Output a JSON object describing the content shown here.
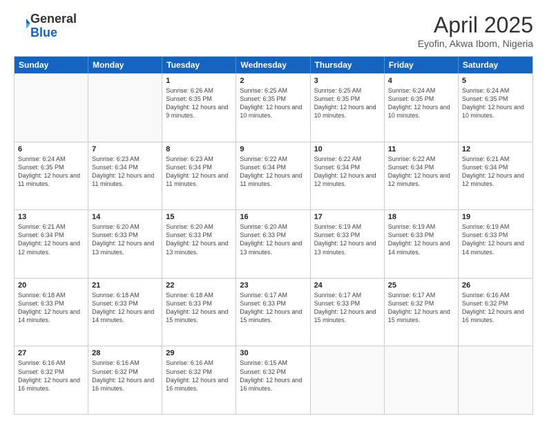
{
  "logo": {
    "general": "General",
    "blue": "Blue"
  },
  "header": {
    "month": "April 2025",
    "location": "Eyofin, Akwa Ibom, Nigeria"
  },
  "days_of_week": [
    "Sunday",
    "Monday",
    "Tuesday",
    "Wednesday",
    "Thursday",
    "Friday",
    "Saturday"
  ],
  "weeks": [
    [
      {
        "day": "",
        "empty": true
      },
      {
        "day": "",
        "empty": true
      },
      {
        "day": "1",
        "sunrise": "Sunrise: 6:26 AM",
        "sunset": "Sunset: 6:35 PM",
        "daylight": "Daylight: 12 hours and 9 minutes."
      },
      {
        "day": "2",
        "sunrise": "Sunrise: 6:25 AM",
        "sunset": "Sunset: 6:35 PM",
        "daylight": "Daylight: 12 hours and 10 minutes."
      },
      {
        "day": "3",
        "sunrise": "Sunrise: 6:25 AM",
        "sunset": "Sunset: 6:35 PM",
        "daylight": "Daylight: 12 hours and 10 minutes."
      },
      {
        "day": "4",
        "sunrise": "Sunrise: 6:24 AM",
        "sunset": "Sunset: 6:35 PM",
        "daylight": "Daylight: 12 hours and 10 minutes."
      },
      {
        "day": "5",
        "sunrise": "Sunrise: 6:24 AM",
        "sunset": "Sunset: 6:35 PM",
        "daylight": "Daylight: 12 hours and 10 minutes."
      }
    ],
    [
      {
        "day": "6",
        "sunrise": "Sunrise: 6:24 AM",
        "sunset": "Sunset: 6:35 PM",
        "daylight": "Daylight: 12 hours and 11 minutes."
      },
      {
        "day": "7",
        "sunrise": "Sunrise: 6:23 AM",
        "sunset": "Sunset: 6:34 PM",
        "daylight": "Daylight: 12 hours and 11 minutes."
      },
      {
        "day": "8",
        "sunrise": "Sunrise: 6:23 AM",
        "sunset": "Sunset: 6:34 PM",
        "daylight": "Daylight: 12 hours and 11 minutes."
      },
      {
        "day": "9",
        "sunrise": "Sunrise: 6:22 AM",
        "sunset": "Sunset: 6:34 PM",
        "daylight": "Daylight: 12 hours and 11 minutes."
      },
      {
        "day": "10",
        "sunrise": "Sunrise: 6:22 AM",
        "sunset": "Sunset: 6:34 PM",
        "daylight": "Daylight: 12 hours and 12 minutes."
      },
      {
        "day": "11",
        "sunrise": "Sunrise: 6:22 AM",
        "sunset": "Sunset: 6:34 PM",
        "daylight": "Daylight: 12 hours and 12 minutes."
      },
      {
        "day": "12",
        "sunrise": "Sunrise: 6:21 AM",
        "sunset": "Sunset: 6:34 PM",
        "daylight": "Daylight: 12 hours and 12 minutes."
      }
    ],
    [
      {
        "day": "13",
        "sunrise": "Sunrise: 6:21 AM",
        "sunset": "Sunset: 6:34 PM",
        "daylight": "Daylight: 12 hours and 12 minutes."
      },
      {
        "day": "14",
        "sunrise": "Sunrise: 6:20 AM",
        "sunset": "Sunset: 6:33 PM",
        "daylight": "Daylight: 12 hours and 13 minutes."
      },
      {
        "day": "15",
        "sunrise": "Sunrise: 6:20 AM",
        "sunset": "Sunset: 6:33 PM",
        "daylight": "Daylight: 12 hours and 13 minutes."
      },
      {
        "day": "16",
        "sunrise": "Sunrise: 6:20 AM",
        "sunset": "Sunset: 6:33 PM",
        "daylight": "Daylight: 12 hours and 13 minutes."
      },
      {
        "day": "17",
        "sunrise": "Sunrise: 6:19 AM",
        "sunset": "Sunset: 6:33 PM",
        "daylight": "Daylight: 12 hours and 13 minutes."
      },
      {
        "day": "18",
        "sunrise": "Sunrise: 6:19 AM",
        "sunset": "Sunset: 6:33 PM",
        "daylight": "Daylight: 12 hours and 14 minutes."
      },
      {
        "day": "19",
        "sunrise": "Sunrise: 6:19 AM",
        "sunset": "Sunset: 6:33 PM",
        "daylight": "Daylight: 12 hours and 14 minutes."
      }
    ],
    [
      {
        "day": "20",
        "sunrise": "Sunrise: 6:18 AM",
        "sunset": "Sunset: 6:33 PM",
        "daylight": "Daylight: 12 hours and 14 minutes."
      },
      {
        "day": "21",
        "sunrise": "Sunrise: 6:18 AM",
        "sunset": "Sunset: 6:33 PM",
        "daylight": "Daylight: 12 hours and 14 minutes."
      },
      {
        "day": "22",
        "sunrise": "Sunrise: 6:18 AM",
        "sunset": "Sunset: 6:33 PM",
        "daylight": "Daylight: 12 hours and 15 minutes."
      },
      {
        "day": "23",
        "sunrise": "Sunrise: 6:17 AM",
        "sunset": "Sunset: 6:33 PM",
        "daylight": "Daylight: 12 hours and 15 minutes."
      },
      {
        "day": "24",
        "sunrise": "Sunrise: 6:17 AM",
        "sunset": "Sunset: 6:33 PM",
        "daylight": "Daylight: 12 hours and 15 minutes."
      },
      {
        "day": "25",
        "sunrise": "Sunrise: 6:17 AM",
        "sunset": "Sunset: 6:32 PM",
        "daylight": "Daylight: 12 hours and 15 minutes."
      },
      {
        "day": "26",
        "sunrise": "Sunrise: 6:16 AM",
        "sunset": "Sunset: 6:32 PM",
        "daylight": "Daylight: 12 hours and 16 minutes."
      }
    ],
    [
      {
        "day": "27",
        "sunrise": "Sunrise: 6:16 AM",
        "sunset": "Sunset: 6:32 PM",
        "daylight": "Daylight: 12 hours and 16 minutes."
      },
      {
        "day": "28",
        "sunrise": "Sunrise: 6:16 AM",
        "sunset": "Sunset: 6:32 PM",
        "daylight": "Daylight: 12 hours and 16 minutes."
      },
      {
        "day": "29",
        "sunrise": "Sunrise: 6:16 AM",
        "sunset": "Sunset: 6:32 PM",
        "daylight": "Daylight: 12 hours and 16 minutes."
      },
      {
        "day": "30",
        "sunrise": "Sunrise: 6:15 AM",
        "sunset": "Sunset: 6:32 PM",
        "daylight": "Daylight: 12 hours and 16 minutes."
      },
      {
        "day": "",
        "empty": true
      },
      {
        "day": "",
        "empty": true
      },
      {
        "day": "",
        "empty": true
      }
    ]
  ]
}
